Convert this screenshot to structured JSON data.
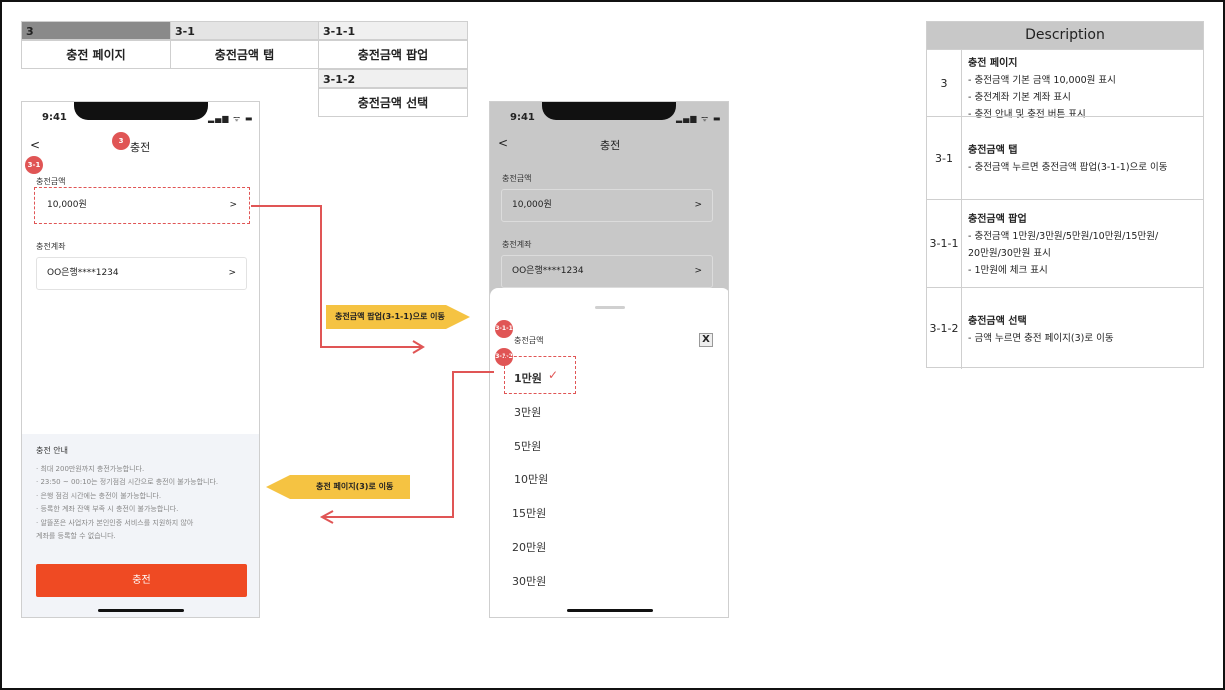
{
  "header": {
    "cols": [
      {
        "num": "3",
        "label": "충전 페이지"
      },
      {
        "num": "3-1",
        "label": "충전금액 탭"
      },
      {
        "num": "3-1-1",
        "label": "충전금액 팝업"
      },
      {
        "num": "3-1-2",
        "label": "충전금액 선택"
      }
    ]
  },
  "phone1": {
    "time": "9:41",
    "status_icons": "▂▄▆ ᯤ ▬",
    "back": "<",
    "title": "충전",
    "badge_title": "3",
    "badge_amount": "3-1",
    "amount_label": "충전금액",
    "amount_value": "10,000원",
    "chevron": ">",
    "account_label": "충전계좌",
    "account_value": "OO은행****1234",
    "guide_title": "충전 안내",
    "guide_lines": [
      "· 최대 200만원까지 충전가능합니다.",
      "· 23:50 ~ 00:10는 정기점검 시간으로 충전이 불가능합니다.",
      "· 은행 점검 시간에는 충전이 불가능합니다.",
      "· 등록한 계좌 잔액 부족 시 충전이 불가능합니다.",
      "· 알뜰폰은 사업자가 본인인증 서비스를 지원하지 않아",
      "   계좌를 등록할 수 없습니다."
    ],
    "button": "충전"
  },
  "phone2": {
    "time": "9:41",
    "status_icons": "▂▄▆ ᯤ ▬",
    "back": "<",
    "title": "충전",
    "amount_label": "충전금액",
    "amount_value": "10,000원",
    "chevron": ">",
    "account_label": "충전계좌",
    "account_value": "OO은행****1234",
    "sheet_label": "충전금액",
    "close": "X",
    "badge_popup": "3-1-1",
    "badge_select": "3-1-2",
    "check": "✓",
    "options": [
      "1만원",
      "3만원",
      "5만원",
      "10만원",
      "15만원",
      "20만원",
      "30만원"
    ]
  },
  "arrows": {
    "to_popup": "충전금액 팝업(3-1-1)으로 이동",
    "to_page": "충전 페이지(3)로 이동"
  },
  "colors": {
    "accent_red": "#e05555",
    "button_orange": "#ef4a23",
    "callout_yellow": "#f5c342"
  },
  "description": {
    "title": "Description",
    "rows": [
      {
        "num": "3",
        "title": "충전 페이지",
        "lines": [
          "- 충전금액 기본 금액 10,000원 표시",
          "- 충전계좌 기본 계좌 표시",
          "- 충전 안내 및 충전 버튼 표시"
        ]
      },
      {
        "num": "3-1",
        "title": "충전금액 탭",
        "lines": [
          "- 충전금액 누르면 충전금액 팝업(3-1-1)으로 이동"
        ]
      },
      {
        "num": "3-1-1",
        "title": "충전금액 팝업",
        "lines": [
          "- 충전금액 1만원/3만원/5만원/10만원/15만원/",
          "   20만원/30만원 표시",
          "- 1만원에 체크 표시"
        ]
      },
      {
        "num": "3-1-2",
        "title": "충전금액 선택",
        "lines": [
          "- 금액 누르면 충전 페이지(3)로 이동"
        ]
      }
    ]
  }
}
